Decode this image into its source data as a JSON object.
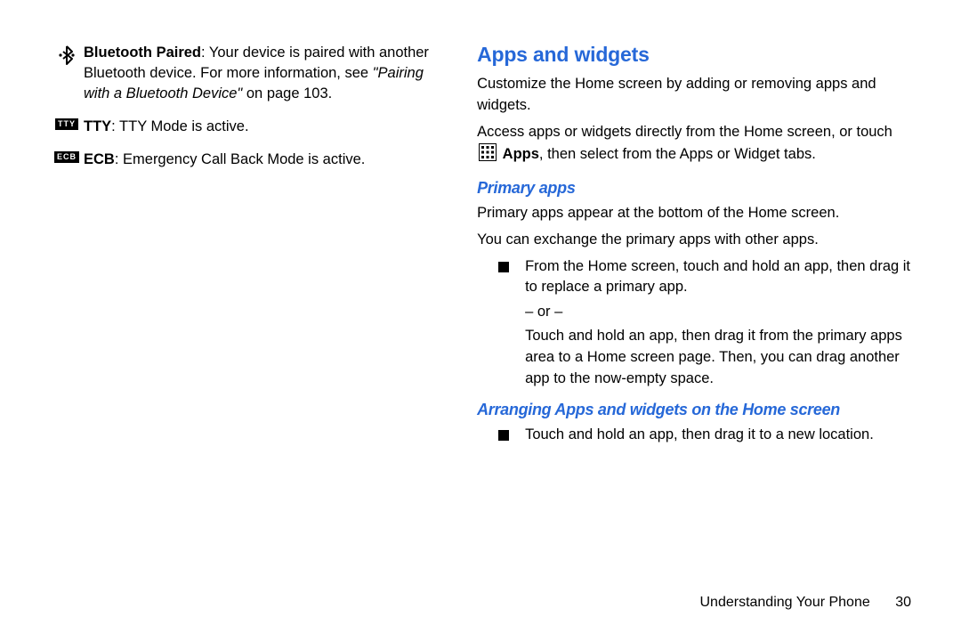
{
  "left": {
    "bluetooth": {
      "term": "Bluetooth Paired",
      "desc1_a": ": Your device is paired with another Bluetooth device. For more information, see ",
      "desc1_italic": "\"Pairing with a Bluetooth Device\"",
      "desc1_b": " on page 103."
    },
    "tty": {
      "badge": "TTY",
      "term": "TTY",
      "desc": ": TTY Mode is active."
    },
    "ecb": {
      "badge": "ECB",
      "term": "ECB",
      "desc": ": Emergency Call Back Mode is active."
    }
  },
  "right": {
    "heading": "Apps and widgets",
    "p1": "Customize the Home screen by adding or removing apps and widgets.",
    "p2_a": "Access apps or widgets directly from the Home screen, or touch ",
    "p2_apps_label": "Apps",
    "p2_b": ", then select from the Apps or Widget tabs.",
    "primary_heading": "Primary apps",
    "primary_p1": "Primary apps appear at the bottom of the Home screen.",
    "primary_p2": "You can exchange the primary apps with other apps.",
    "bullet1": "From the Home screen, touch and hold an app, then drag it to replace a primary app.",
    "or": "– or –",
    "bullet1b": "Touch and hold an app, then drag it from the primary apps area to a Home screen page. Then, you can drag another app to the now-empty space.",
    "arranging_heading": "Arranging Apps and widgets on the Home screen",
    "bullet2": "Touch and hold an app, then drag it to a new location."
  },
  "footer": {
    "section": "Understanding Your Phone",
    "page": "30"
  }
}
